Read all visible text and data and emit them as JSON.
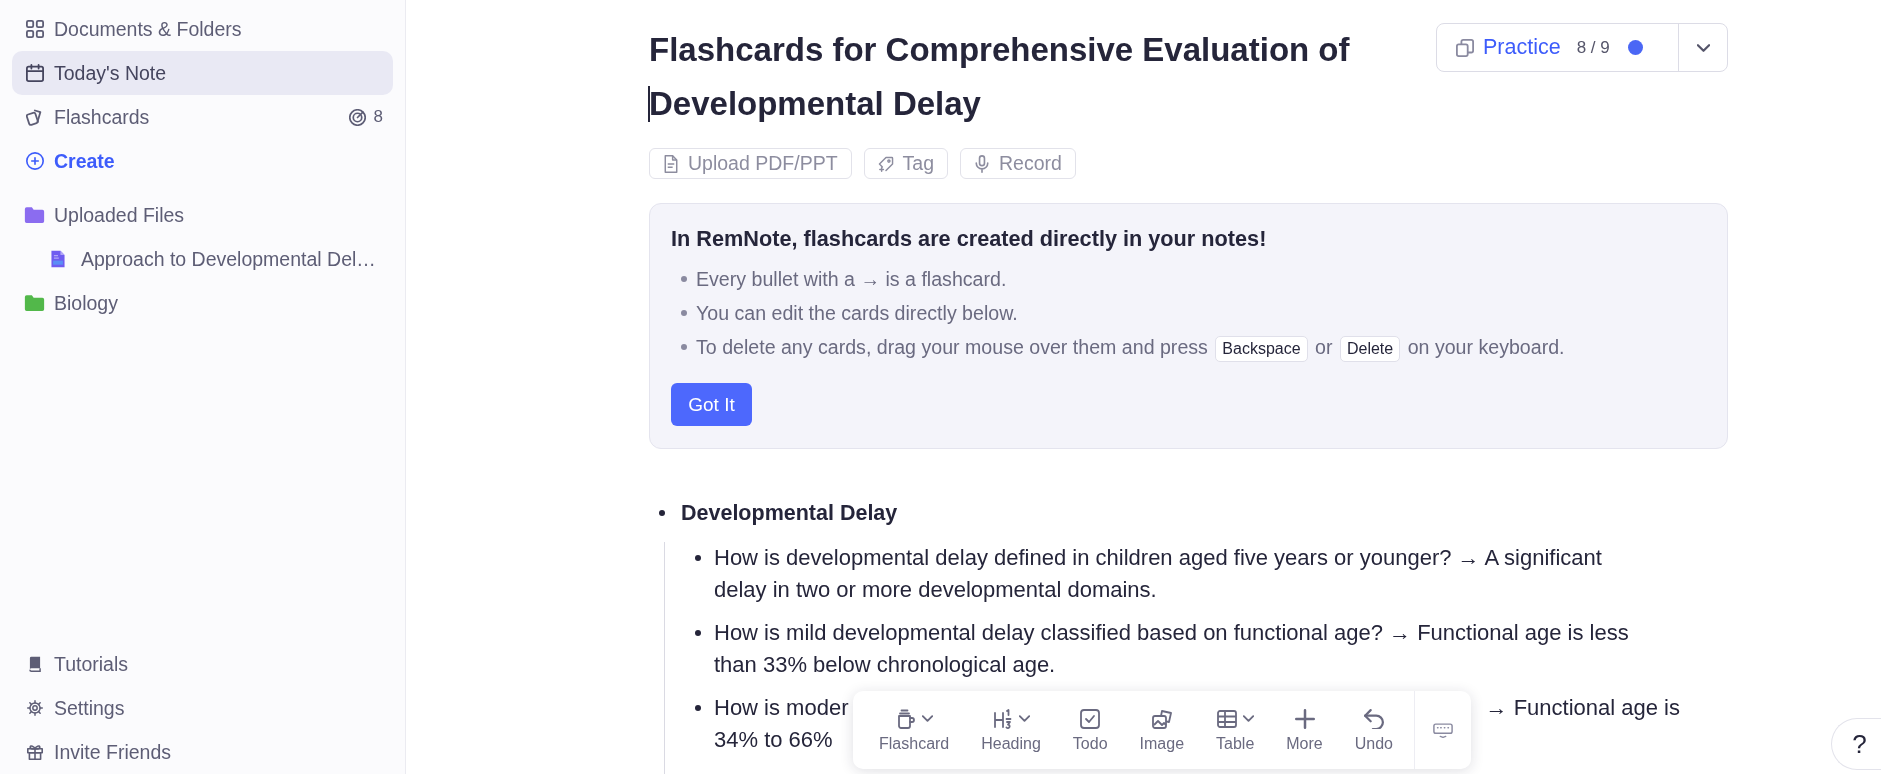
{
  "sidebar": {
    "top_items": [
      {
        "label": "Documents & Folders",
        "kind": "link",
        "selected": false
      },
      {
        "label": "Today's Note",
        "kind": "link",
        "selected": true
      },
      {
        "label": "Flashcards",
        "kind": "link",
        "selected": false,
        "badge": "8"
      },
      {
        "label": "Create",
        "kind": "action",
        "selected": false
      }
    ],
    "folders": [
      {
        "label": "Uploaded Files",
        "color": "#8b6cf0",
        "selected": false,
        "children": [
          {
            "label": "Approach to Developmental Del…",
            "selected": false
          }
        ]
      },
      {
        "label": "Biology",
        "color": "#52b84a",
        "selected": false
      }
    ],
    "bottom_items": [
      {
        "label": "Tutorials",
        "selected": false
      },
      {
        "label": "Settings",
        "selected": false
      },
      {
        "label": "Invite Friends",
        "selected": false
      }
    ]
  },
  "document": {
    "title": "Flashcards for Comprehensive Evaluation of Developmental Delay",
    "practice": {
      "label": "Practice",
      "count": "8 / 9"
    },
    "actions": [
      "Upload PDF/PPT",
      "Tag",
      "Record"
    ]
  },
  "notice": {
    "heading": "In RemNote, flashcards are created directly in your notes!",
    "tips": [
      {
        "parts": [
          {
            "kind": "text",
            "text": "Every bullet with a → is a flashcard."
          }
        ]
      },
      {
        "parts": [
          {
            "kind": "text",
            "text": "You can edit the cards directly below."
          }
        ]
      },
      {
        "parts": [
          {
            "kind": "text",
            "text": "To delete any cards, drag your mouse over them and press"
          },
          {
            "kind": "key",
            "text": "Backspace"
          },
          {
            "kind": "text",
            "text": "or"
          },
          {
            "kind": "key",
            "text": "Delete"
          },
          {
            "kind": "text",
            "text": "on your keyboard."
          }
        ]
      }
    ],
    "button": "Got It"
  },
  "outline": {
    "heading": "Developmental Delay",
    "children": [
      {
        "kind": "card",
        "text": "How is developmental delay defined in children aged five years or younger? → A significant delay in two or more developmental domains."
      },
      {
        "kind": "card",
        "text": "How is mild developmental delay classified based on functional age? → Functional age is less than 33% below chronological age."
      },
      {
        "kind": "covered",
        "line_1_start": "How is moder",
        "line_1_end": "→ Functional age is",
        "line_2_start": "34% to 66%"
      }
    ]
  },
  "toolbar": {
    "tools": [
      {
        "label": "Flashcard",
        "dropdown": true
      },
      {
        "label": "Heading",
        "dropdown": true
      },
      {
        "label": "Todo",
        "dropdown": false
      },
      {
        "label": "Image",
        "dropdown": false
      },
      {
        "label": "Table",
        "dropdown": true
      },
      {
        "label": "More",
        "dropdown": false
      },
      {
        "label": "Undo",
        "dropdown": false
      }
    ]
  },
  "help_button": "?"
}
